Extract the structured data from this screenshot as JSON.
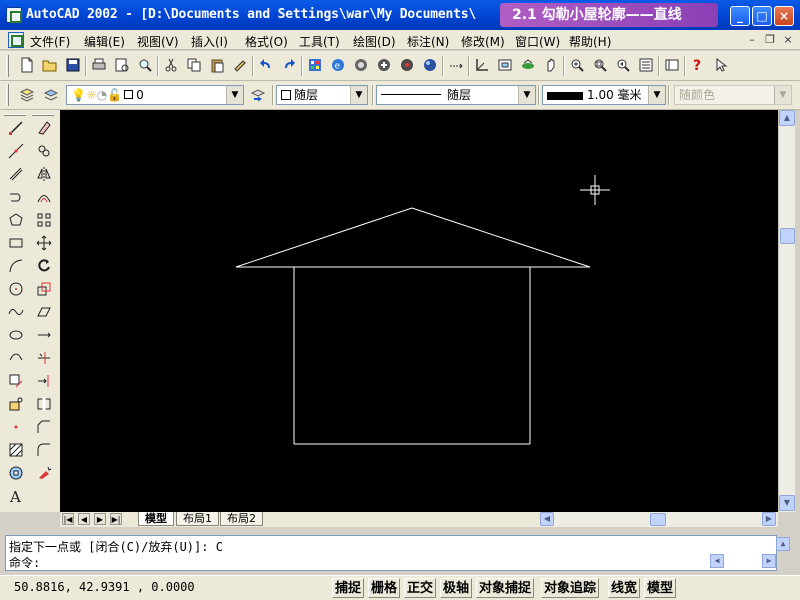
{
  "window": {
    "title": "AutoCAD 2002 - [D:\\Documents and Settings\\war\\My Documents\\",
    "lesson_banner": "2.1 勾勒小屋轮廓——直线",
    "controls": {
      "minimize": "_",
      "maximize": "□",
      "close": "×"
    }
  },
  "menu": {
    "items": [
      "文件(F)",
      "编辑(E)",
      "视图(V)",
      "插入(I)",
      "格式(O)",
      "工具(T)",
      "绘图(D)",
      "标注(N)",
      "修改(M)",
      "窗口(W)",
      "帮助(H)"
    ],
    "doc_controls": {
      "minimize": "–",
      "restore": "❐",
      "close": "×"
    }
  },
  "standard_toolbar": {
    "icons": [
      "new-icon",
      "open-icon",
      "save-icon",
      "print-icon",
      "print-preview-icon",
      "find-icon",
      "cut-icon",
      "copy-icon",
      "paste-icon",
      "match-properties-icon",
      "undo-icon",
      "redo-icon",
      "design-center-icon",
      "internet-icon",
      "layer-tool-icon",
      "object-properties-icon",
      "tool-palette-icon",
      "render-icon",
      "distance-icon",
      "ucs-icon",
      "named-views-icon",
      "3d-orbit-icon",
      "pan-icon",
      "zoom-realtime-icon",
      "zoom-window-icon",
      "zoom-previous-icon",
      "properties-icon",
      "adcenter-icon",
      "help-icon",
      "arrow-icon"
    ]
  },
  "properties_toolbar": {
    "layer_value": "0",
    "color_value": "随层",
    "linetype_value": "随层",
    "lineweight_value": "1.00 毫米",
    "plotstyle_value": "随颜色"
  },
  "draw_tools": [
    "line-icon",
    "construction-line-icon",
    "multiline-icon",
    "polyline-icon",
    "polygon-icon",
    "rectangle-icon",
    "arc-icon",
    "circle-icon",
    "spline-icon",
    "ellipse-icon",
    "ellipse-arc-icon",
    "insert-block-icon",
    "make-block-icon",
    "point-icon",
    "hatch-icon",
    "region-icon",
    "text-icon"
  ],
  "modify_tools": [
    "erase-icon",
    "copy-object-icon",
    "mirror-icon",
    "offset-icon",
    "array-icon",
    "move-icon",
    "rotate-icon",
    "scale-icon",
    "stretch-icon",
    "lengthen-icon",
    "trim-icon",
    "extend-icon",
    "break-icon",
    "chamfer-icon",
    "fillet-icon",
    "explode-icon"
  ],
  "layout_tabs": [
    "模型",
    "布局1",
    "布局2"
  ],
  "command_area": {
    "line1": "指定下一点或 [闭合(C)/放弃(U)]: C",
    "line2": "命令:"
  },
  "status": {
    "coordinates": "50.8816, 42.9391 , 0.0000",
    "buttons": [
      "捕捉",
      "栅格",
      "正交",
      "极轴",
      "对象捕捉",
      "对象追踪",
      "线宽",
      "模型"
    ]
  },
  "colors": {
    "title_bar": "#0043d0",
    "banner": "#a24fc0",
    "canvas": "#000000",
    "drawing_lines": "#ffffff"
  }
}
